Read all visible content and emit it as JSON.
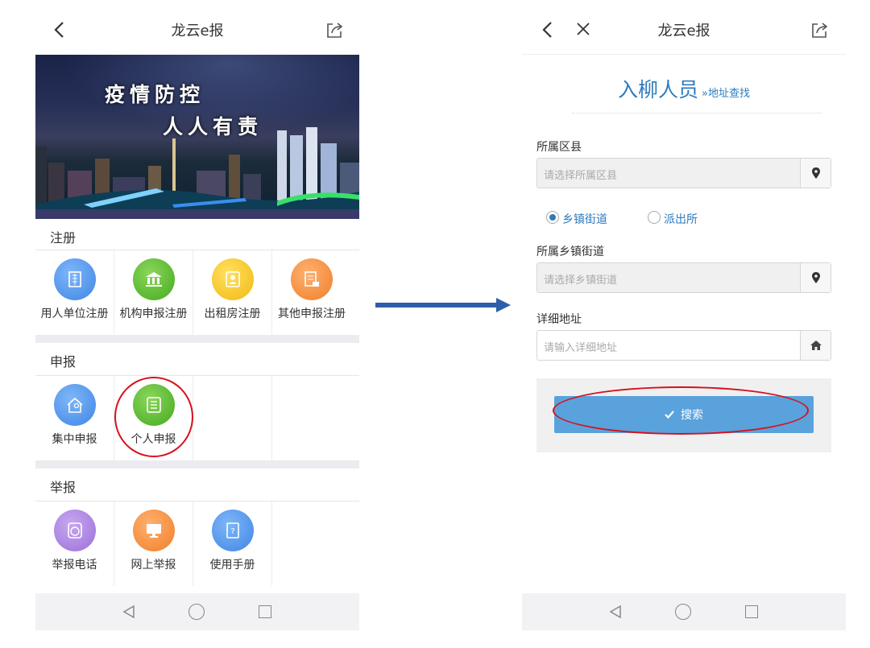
{
  "left_screen": {
    "title": "龙云e报",
    "banner": {
      "line1": "疫情防控",
      "line2": "人人有责"
    },
    "sections": [
      {
        "label": "注册",
        "items": [
          {
            "label": "用人单位注册",
            "icon": "building-icon",
            "color": "#4a90e2"
          },
          {
            "label": "机构申报注册",
            "icon": "institution-icon",
            "color": "#4cae24"
          },
          {
            "label": "出租房注册",
            "icon": "id-card-icon",
            "color": "#f3c01c"
          },
          {
            "label": "其他申报注册",
            "icon": "document-edit-icon",
            "color": "#f0842e"
          }
        ]
      },
      {
        "label": "申报",
        "items": [
          {
            "label": "集中申报",
            "icon": "house-person-icon",
            "color": "#4a90e2"
          },
          {
            "label": "个人申报",
            "icon": "form-list-icon",
            "color": "#4cae24"
          }
        ]
      },
      {
        "label": "举报",
        "items": [
          {
            "label": "举报电话",
            "icon": "report-phone-icon",
            "color": "#a07ddc"
          },
          {
            "label": "网上举报",
            "icon": "monitor-icon",
            "color": "#f0842e"
          },
          {
            "label": "使用手册",
            "icon": "manual-book-icon",
            "color": "#4a90e2"
          }
        ]
      }
    ]
  },
  "right_screen": {
    "title": "龙云e报",
    "heading": "入柳人员",
    "subheading": "»地址查找",
    "district": {
      "label": "所属区县",
      "placeholder": "请选择所属区县"
    },
    "radios": [
      {
        "label": "乡镇街道",
        "checked": true
      },
      {
        "label": "派出所",
        "checked": false
      }
    ],
    "street": {
      "label": "所属乡镇街道",
      "placeholder": "请选择乡镇街道"
    },
    "address": {
      "label": "详细地址",
      "placeholder": "请输入详细地址"
    },
    "search_button": "搜索"
  },
  "colors": {
    "accent": "#2d7bbf",
    "button": "#5aa2dc",
    "highlight": "#d8101c",
    "arrow": "#2f5ea8"
  }
}
